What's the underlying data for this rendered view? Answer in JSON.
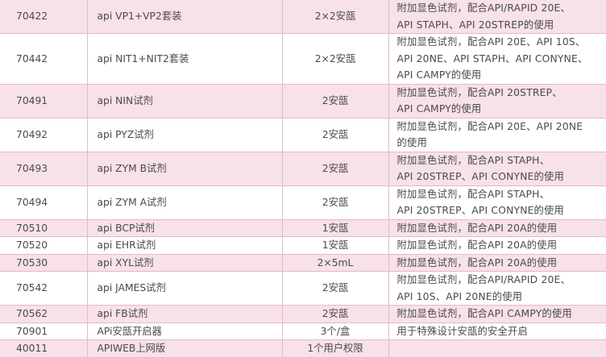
{
  "rows": [
    {
      "code": "70422",
      "name": "api VP1+VP2套装",
      "qty": "2×2安瓿",
      "desc": [
        "附加显色试剂，配合API/RAPID 20E、",
        "API STAPH、API 20STREP的使用"
      ]
    },
    {
      "code": "70442",
      "name": "api NIT1+NIT2套装",
      "qty": "2×2安瓿",
      "desc": [
        "附加显色试剂，配合API 20E、API 10S、",
        "API 20NE、API STAPH、API CONYNE、",
        "API CAMPY的使用"
      ]
    },
    {
      "code": "70491",
      "name": "api NIN试剂",
      "qty": "2安瓿",
      "desc": [
        "附加显色试剂，配合API 20STREP、",
        "API CAMPY的使用"
      ]
    },
    {
      "code": "70492",
      "name": "api PYZ试剂",
      "qty": "2安瓿",
      "desc": [
        "附加显色试剂，配合API 20E、API 20NE",
        "的使用"
      ]
    },
    {
      "code": "70493",
      "name": "api ZYM B试剂",
      "qty": "2安瓿",
      "desc": [
        "附加显色试剂，配合API STAPH、",
        "API 20STREP、API CONYNE的使用"
      ]
    },
    {
      "code": "70494",
      "name": "api ZYM A试剂",
      "qty": "2安瓿",
      "desc": [
        "附加显色试剂，配合API STAPH、",
        "API 20STREP、API CONYNE的使用"
      ]
    },
    {
      "code": "70510",
      "name": "api BCP试剂",
      "qty": "1安瓿",
      "desc": [
        "附加显色试剂，配合API 20A的使用"
      ]
    },
    {
      "code": "70520",
      "name": "api EHR试剂",
      "qty": "1安瓿",
      "desc": [
        "附加显色试剂，配合API 20A的使用"
      ]
    },
    {
      "code": "70530",
      "name": "api XYL试剂",
      "qty": "2×5mL",
      "desc": [
        "附加显色试剂，配合API 20A的使用"
      ]
    },
    {
      "code": "70542",
      "name": "api JAMES试剂",
      "qty": "2安瓿",
      "desc": [
        "附加显色试剂，配合API/RAPID 20E、",
        "API 10S、API 20NE的使用"
      ]
    },
    {
      "code": "70562",
      "name": "api FB试剂",
      "qty": "2安瓿",
      "desc": [
        "附加显色试剂，配合API CAMPY的使用"
      ]
    },
    {
      "code": "70901",
      "name": "APi安瓿开启器",
      "qty": "3个/盒",
      "desc": [
        "用于特殊设计安瓿的安全开启"
      ]
    },
    {
      "code": "40011",
      "name": "APIWEB上网版",
      "qty": "1个用户权限",
      "desc": [
        ""
      ]
    }
  ]
}
